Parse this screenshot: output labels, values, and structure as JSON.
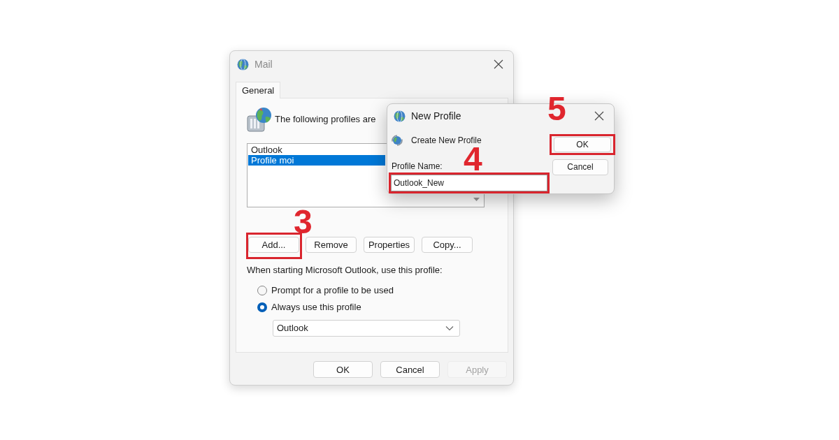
{
  "mail_window": {
    "title": "Mail",
    "tabs": [
      {
        "label": "General",
        "selected": true
      }
    ],
    "intro_text": "The following profiles are",
    "profiles": [
      {
        "label": "Outlook",
        "selected": false
      },
      {
        "label": "Profile moi",
        "selected": true
      }
    ],
    "profile_buttons": [
      {
        "label": "Add...",
        "highlighted": true
      },
      {
        "label": "Remove",
        "highlighted": false
      },
      {
        "label": "Properties",
        "highlighted": false
      },
      {
        "label": "Copy...",
        "highlighted": false
      }
    ],
    "startup_label": "When starting Microsoft Outlook, use this profile:",
    "startup_options": [
      {
        "label": "Prompt for a profile to be used",
        "selected": false
      },
      {
        "label": "Always use this profile",
        "selected": true
      }
    ],
    "profile_select": {
      "value": "Outlook"
    },
    "buttons": [
      {
        "label": "OK",
        "disabled": false
      },
      {
        "label": "Cancel",
        "disabled": false
      },
      {
        "label": "Apply",
        "disabled": true
      }
    ]
  },
  "new_profile_window": {
    "title": "New Profile",
    "heading": "Create New Profile",
    "field_label": "Profile Name:",
    "profile_name": {
      "value": "Outlook_New",
      "highlighted": true
    },
    "buttons": [
      {
        "label": "OK",
        "highlighted": true
      },
      {
        "label": "Cancel",
        "highlighted": false
      }
    ]
  },
  "step_markers": [
    {
      "label": "3"
    },
    {
      "label": "4"
    },
    {
      "label": "5"
    }
  ]
}
